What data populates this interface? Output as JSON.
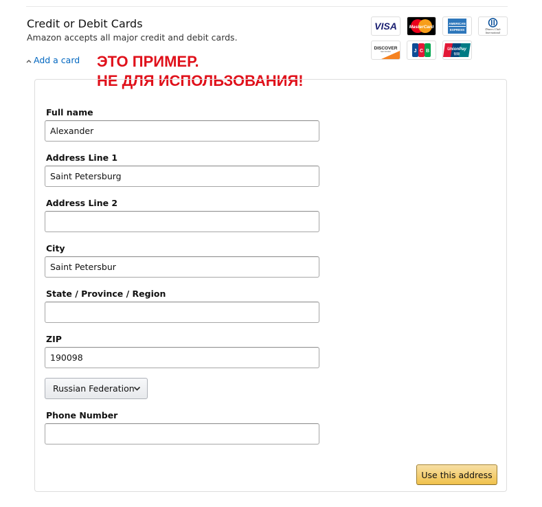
{
  "header": {
    "title": "Credit or Debit Cards",
    "subtitle": "Amazon accepts all major credit and debit cards.",
    "add_card_label": "Add a card"
  },
  "watermark": {
    "line1": "ЭТО ПРИМЕР.",
    "line2": "НЕ ДЛЯ ИСПОЛЬЗОВАНИЯ!",
    "color": "#e0111b"
  },
  "card_logos": [
    {
      "name": "visa-logo",
      "text": "VISA"
    },
    {
      "name": "mastercard-logo",
      "text": "MasterCard"
    },
    {
      "name": "amex-logo",
      "text": "AMERICAN EXPRESS"
    },
    {
      "name": "diners-club-logo",
      "text": "Diners Club International"
    },
    {
      "name": "discover-logo",
      "text": "DISCOVER"
    },
    {
      "name": "jcb-logo",
      "text": "JCB"
    },
    {
      "name": "unionpay-logo",
      "text": "UnionPay"
    }
  ],
  "form": {
    "full_name": {
      "label": "Full name",
      "value": "Alexander"
    },
    "address1": {
      "label": "Address Line 1",
      "value": "Saint Petersburg"
    },
    "address2": {
      "label": "Address Line 2",
      "value": ""
    },
    "city": {
      "label": "City",
      "value": "Saint Petersbur"
    },
    "state": {
      "label": "State / Province / Region",
      "value": ""
    },
    "zip": {
      "label": "ZIP",
      "value": "190098"
    },
    "country": {
      "selected": "Russian Federation"
    },
    "phone": {
      "label": "Phone Number",
      "value": ""
    },
    "submit_label": "Use this address"
  },
  "colors": {
    "link": "#0066c0",
    "button_gradient_top": "#f7dfa5",
    "button_gradient_bottom": "#f0c14b"
  }
}
